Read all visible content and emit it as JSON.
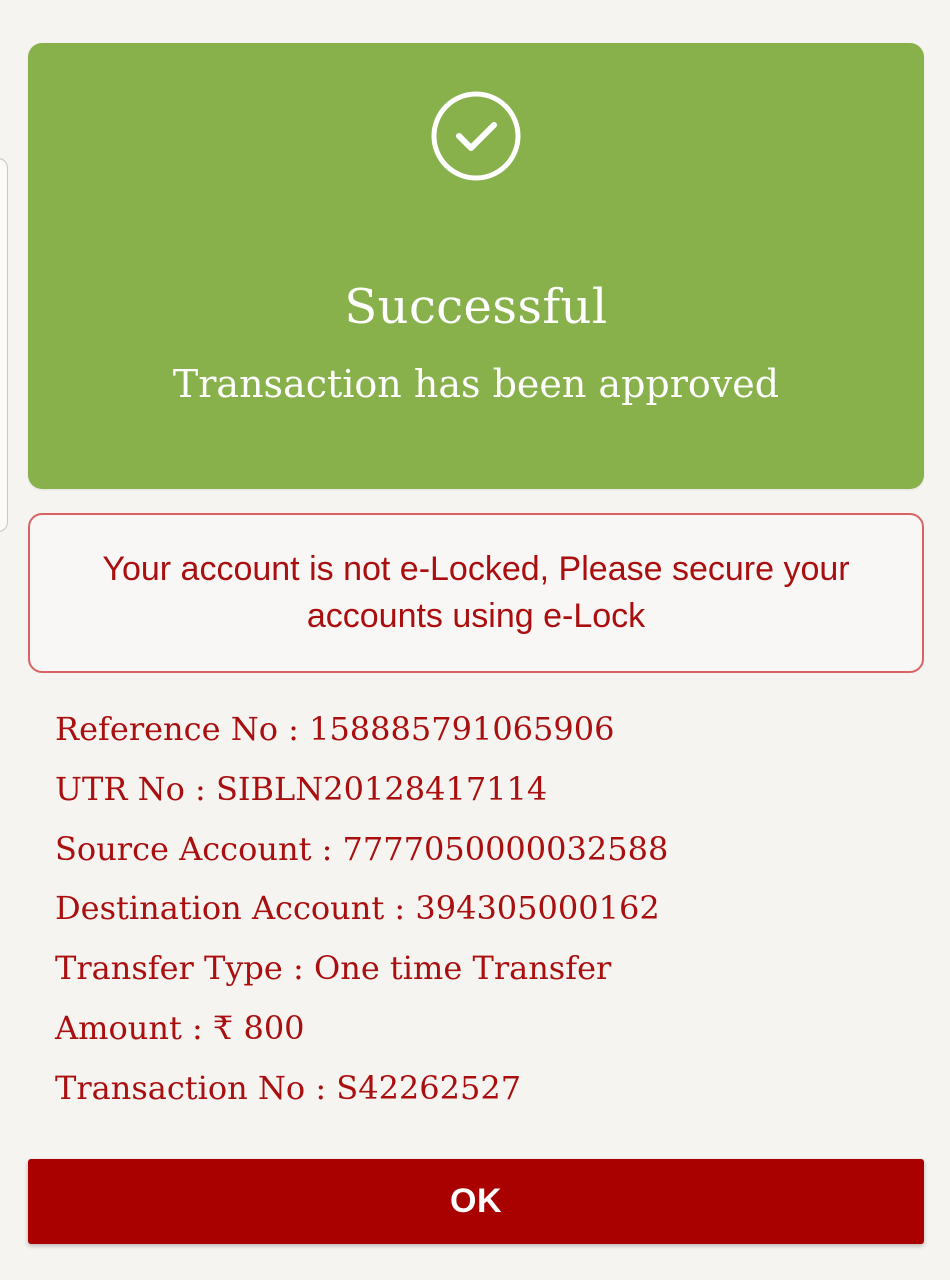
{
  "success": {
    "icon": "check-circle-icon",
    "title": "Successful",
    "subtitle": "Transaction has been approved",
    "color": "#88b04b"
  },
  "warning": {
    "message": "Your account is not e-Locked, Please secure your accounts using e-Lock",
    "color": "#a90f0f",
    "border_color": "#d96363"
  },
  "details": [
    {
      "label": "Reference No",
      "value": "158885791065906"
    },
    {
      "label": "UTR No",
      "value": "SIBLN20128417114"
    },
    {
      "label": "Source Account",
      "value": "7777050000032588"
    },
    {
      "label": "Destination Account",
      "value": "394305000162"
    },
    {
      "label": "Transfer Type",
      "value": "One time Transfer"
    },
    {
      "label": "Amount",
      "value": "₹ 800"
    },
    {
      "label": "Transaction No",
      "value": "S42262527"
    }
  ],
  "actions": {
    "ok_label": "OK",
    "button_color": "#a90000"
  },
  "background_color": "#f6f4f1"
}
